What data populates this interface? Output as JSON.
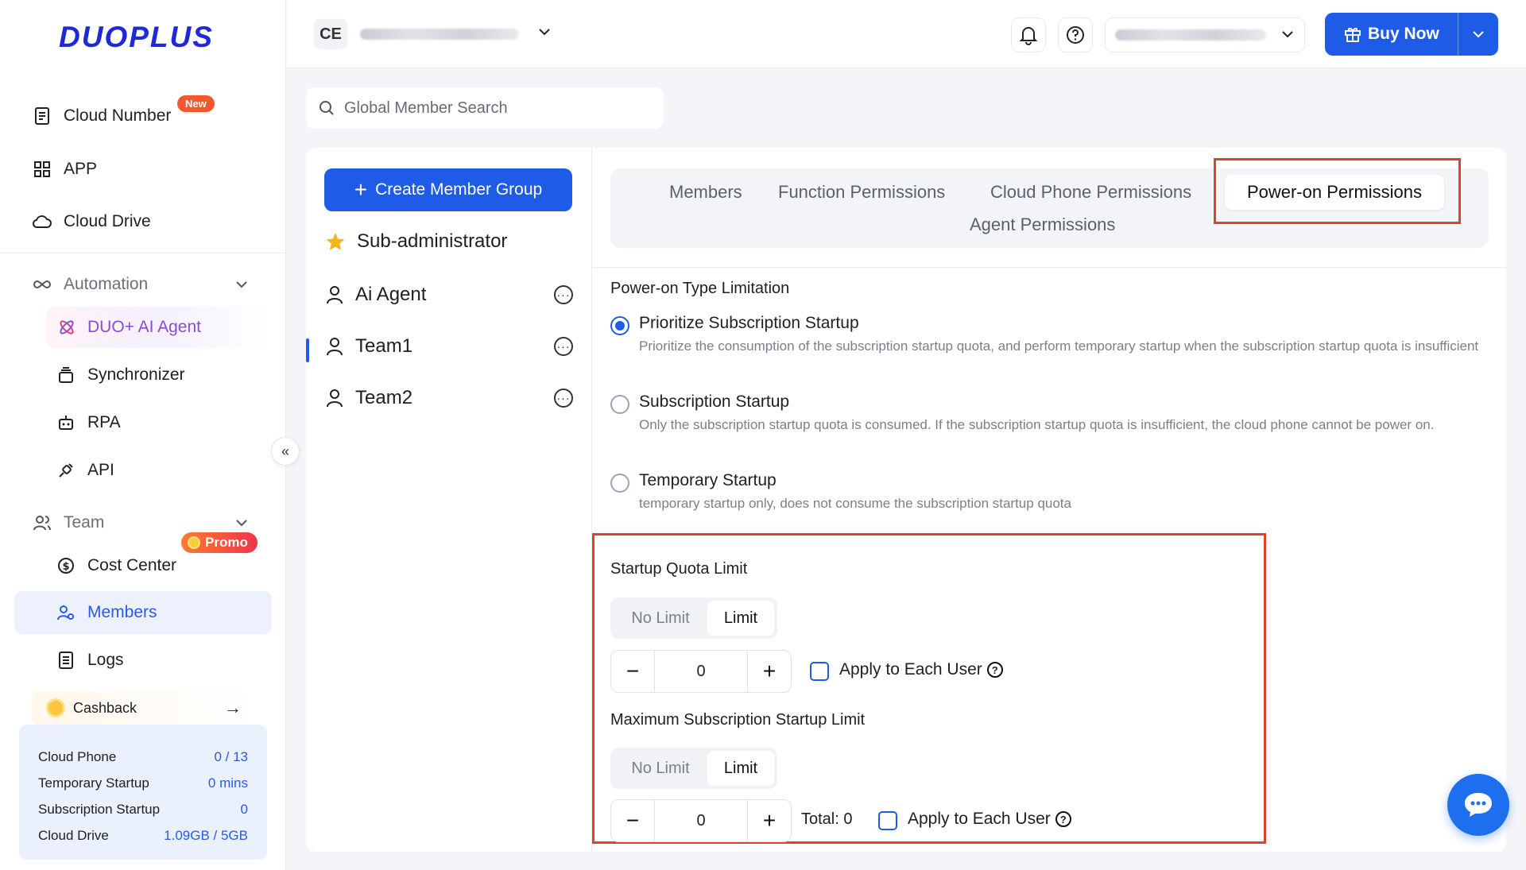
{
  "brand": {
    "logo_text": "DUOPLUS"
  },
  "sidebar": {
    "cloud_number": "Cloud Number",
    "new_badge": "New",
    "app": "APP",
    "cloud_drive": "Cloud Drive",
    "automation": "Automation",
    "ai_agent": "DUO+ AI Agent",
    "synchronizer": "Synchronizer",
    "rpa": "RPA",
    "api": "API",
    "team": "Team",
    "cost_center": "Cost Center",
    "promo_badge": "Promo",
    "members": "Members",
    "logs": "Logs",
    "collapse_icon": "«",
    "cashback": "Cashback",
    "cashback_arrow": "→",
    "usage": [
      {
        "label": "Cloud Phone",
        "value": "0 / 13"
      },
      {
        "label": "Temporary Startup",
        "value": "0 mins"
      },
      {
        "label": "Subscription Startup",
        "value": "0"
      },
      {
        "label": "Cloud Drive",
        "value": "1.09GB / 5GB"
      }
    ]
  },
  "topbar": {
    "org_initials": "CE",
    "buy_now": "Buy Now"
  },
  "search": {
    "placeholder": "Global Member Search"
  },
  "groups": {
    "create_label": "Create Member Group",
    "create_plus": "+",
    "items": [
      {
        "name": "Sub-administrator"
      },
      {
        "name": "Ai Agent"
      },
      {
        "name": "Team1"
      },
      {
        "name": "Team2"
      }
    ],
    "more_glyph": "···"
  },
  "tabs": {
    "members": "Members",
    "function": "Function Permissions",
    "cloud_phone": "Cloud Phone Permissions",
    "power_on": "Power-on Permissions",
    "agent": "Agent Permissions"
  },
  "power_on": {
    "type_title": "Power-on Type Limitation",
    "options": [
      {
        "label": "Prioritize Subscription Startup",
        "desc": "Prioritize the consumption of the subscription startup quota, and perform temporary startup when the subscription startup quota is insufficient"
      },
      {
        "label": "Subscription Startup",
        "desc": "Only the subscription startup quota is consumed. If the subscription startup quota is insufficient, the cloud phone cannot be power on."
      },
      {
        "label": "Temporary Startup",
        "desc": "temporary startup only, does not consume the subscription startup quota"
      }
    ],
    "startup_quota_title": "Startup Quota Limit",
    "max_sub_title": "Maximum Subscription Startup Limit",
    "no_limit": "No Limit",
    "limit": "Limit",
    "minus": "−",
    "plus": "+",
    "quota_value": "0",
    "max_value": "0",
    "apply_each": "Apply to Each User",
    "help_glyph": "?",
    "total": "Total: 0"
  },
  "colors": {
    "accent": "#1e5ce8",
    "highlight": "#d9432f"
  }
}
